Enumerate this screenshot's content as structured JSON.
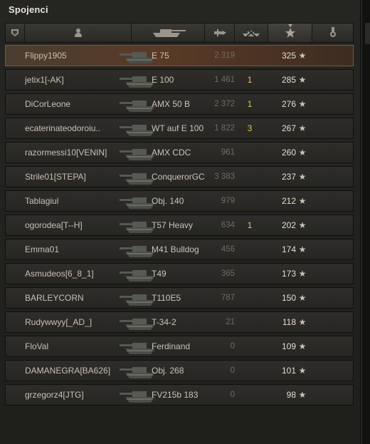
{
  "panel": {
    "title": "Spojenci"
  },
  "columns": [
    {
      "id": "squad",
      "icon": "squad-shield-icon"
    },
    {
      "id": "player",
      "icon": "player-silhouette-icon"
    },
    {
      "id": "tank",
      "icon": "tank-icon"
    },
    {
      "id": "damage",
      "icon": "damage-shell-icon"
    },
    {
      "id": "kills",
      "icon": "destroyed-tanks-icon"
    },
    {
      "id": "xp",
      "icon": "star-icon",
      "sorted": true
    },
    {
      "id": "medal",
      "icon": "medal-icon"
    }
  ],
  "colors": {
    "kills": "#e1c25a",
    "self_row": "#5a3a26"
  },
  "players": [
    {
      "name": "Flippy1905",
      "tank": "E 75",
      "damage": "2 319",
      "kills": "",
      "xp": "325",
      "self": true
    },
    {
      "name": "jetix1[-AK]",
      "tank": "E 100",
      "damage": "1 461",
      "kills": "1",
      "xp": "285"
    },
    {
      "name": "DiCorLeone",
      "tank": "AMX 50 B",
      "damage": "2 372",
      "kills": "1",
      "xp": "276"
    },
    {
      "name": "ecaterinateodoroiu..",
      "tank": "WT auf E 100",
      "damage": "1 822",
      "kills": "3",
      "xp": "267"
    },
    {
      "name": "razormessi10[VENIN]",
      "tank": "AMX CDC",
      "damage": "961",
      "kills": "",
      "xp": "260"
    },
    {
      "name": "Strile01[STEPA]",
      "tank": "ConquerorGC",
      "damage": "3 383",
      "kills": "",
      "xp": "237"
    },
    {
      "name": "Tablagiul",
      "tank": "Obj. 140",
      "damage": "979",
      "kills": "",
      "xp": "212"
    },
    {
      "name": "ogorodea[T--H]",
      "tank": "T57 Heavy",
      "damage": "634",
      "kills": "1",
      "xp": "202"
    },
    {
      "name": "Emma01",
      "tank": "M41 Bulldog",
      "damage": "456",
      "kills": "",
      "xp": "174"
    },
    {
      "name": "Asmudeos[6_8_1]",
      "tank": "T49",
      "damage": "365",
      "kills": "",
      "xp": "173"
    },
    {
      "name": "BARLEYCORN",
      "tank": "T110E5",
      "damage": "787",
      "kills": "",
      "xp": "150"
    },
    {
      "name": "Rudywwyy[_AD_]",
      "tank": "T-34-2",
      "damage": "21",
      "kills": "",
      "xp": "118"
    },
    {
      "name": "FloVal",
      "tank": "Ferdinand",
      "damage": "0",
      "kills": "",
      "xp": "109"
    },
    {
      "name": "DAMANEGRA[BA626]",
      "tank": "Obj. 268",
      "damage": "0",
      "kills": "",
      "xp": "101"
    },
    {
      "name": "grzegorz4[JTG]",
      "tank": "FV215b 183",
      "damage": "0",
      "kills": "",
      "xp": "98"
    }
  ],
  "star_glyph": "★"
}
